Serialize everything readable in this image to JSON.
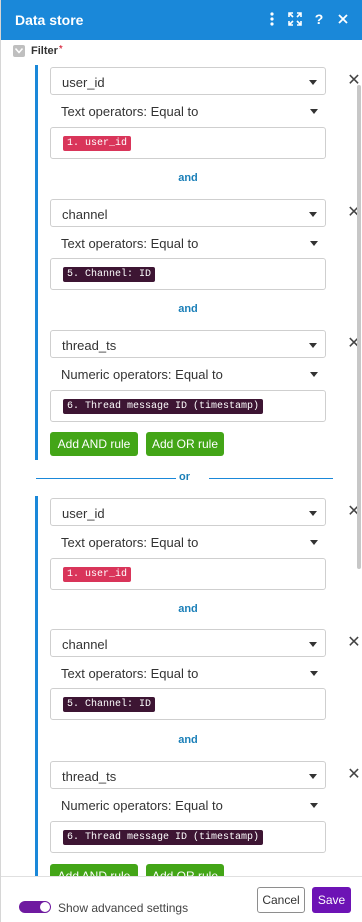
{
  "header": {
    "title": "Data store",
    "icons": [
      "more-vertical-icon",
      "expand-icon",
      "help-icon",
      "close-icon"
    ]
  },
  "filter": {
    "label": "Filter",
    "required_mark": "*"
  },
  "or_groups": [
    {
      "conditions": [
        {
          "field": "user_id",
          "operator": "Text operators: Equal to",
          "value": "1. user_id",
          "value_color": "#d9355a"
        },
        {
          "field": "channel",
          "operator": "Text operators: Equal to",
          "value": "5. Channel: ID",
          "value_color": "#3d1533"
        },
        {
          "field": "thread_ts",
          "operator": "Numeric operators: Equal to",
          "value": "6. Thread message ID (timestamp)",
          "value_color": "#3d1533"
        }
      ],
      "and_label": "and",
      "add_and_label": "Add AND rule",
      "add_or_label": "Add OR rule"
    },
    {
      "conditions": [
        {
          "field": "user_id",
          "operator": "Text operators: Equal to",
          "value": "1. user_id",
          "value_color": "#d9355a"
        },
        {
          "field": "channel",
          "operator": "Text operators: Equal to",
          "value": "5. Channel: ID",
          "value_color": "#3d1533"
        },
        {
          "field": "thread_ts",
          "operator": "Numeric operators: Equal to",
          "value": "6. Thread message ID (timestamp)",
          "value_color": "#3d1533"
        }
      ],
      "and_label": "and",
      "add_and_label": "Add AND rule",
      "add_or_label": "Add OR rule"
    }
  ],
  "or_label": "or",
  "footer": {
    "advanced_label": "Show advanced settings",
    "advanced_enabled": true,
    "cancel_label": "Cancel",
    "save_label": "Save"
  },
  "colors": {
    "header": "#1a88d9",
    "group_border": "#1a88d9",
    "button_green": "#43a517",
    "save_purple": "#6d13b5",
    "toggle_purple": "#6f1aa0"
  }
}
